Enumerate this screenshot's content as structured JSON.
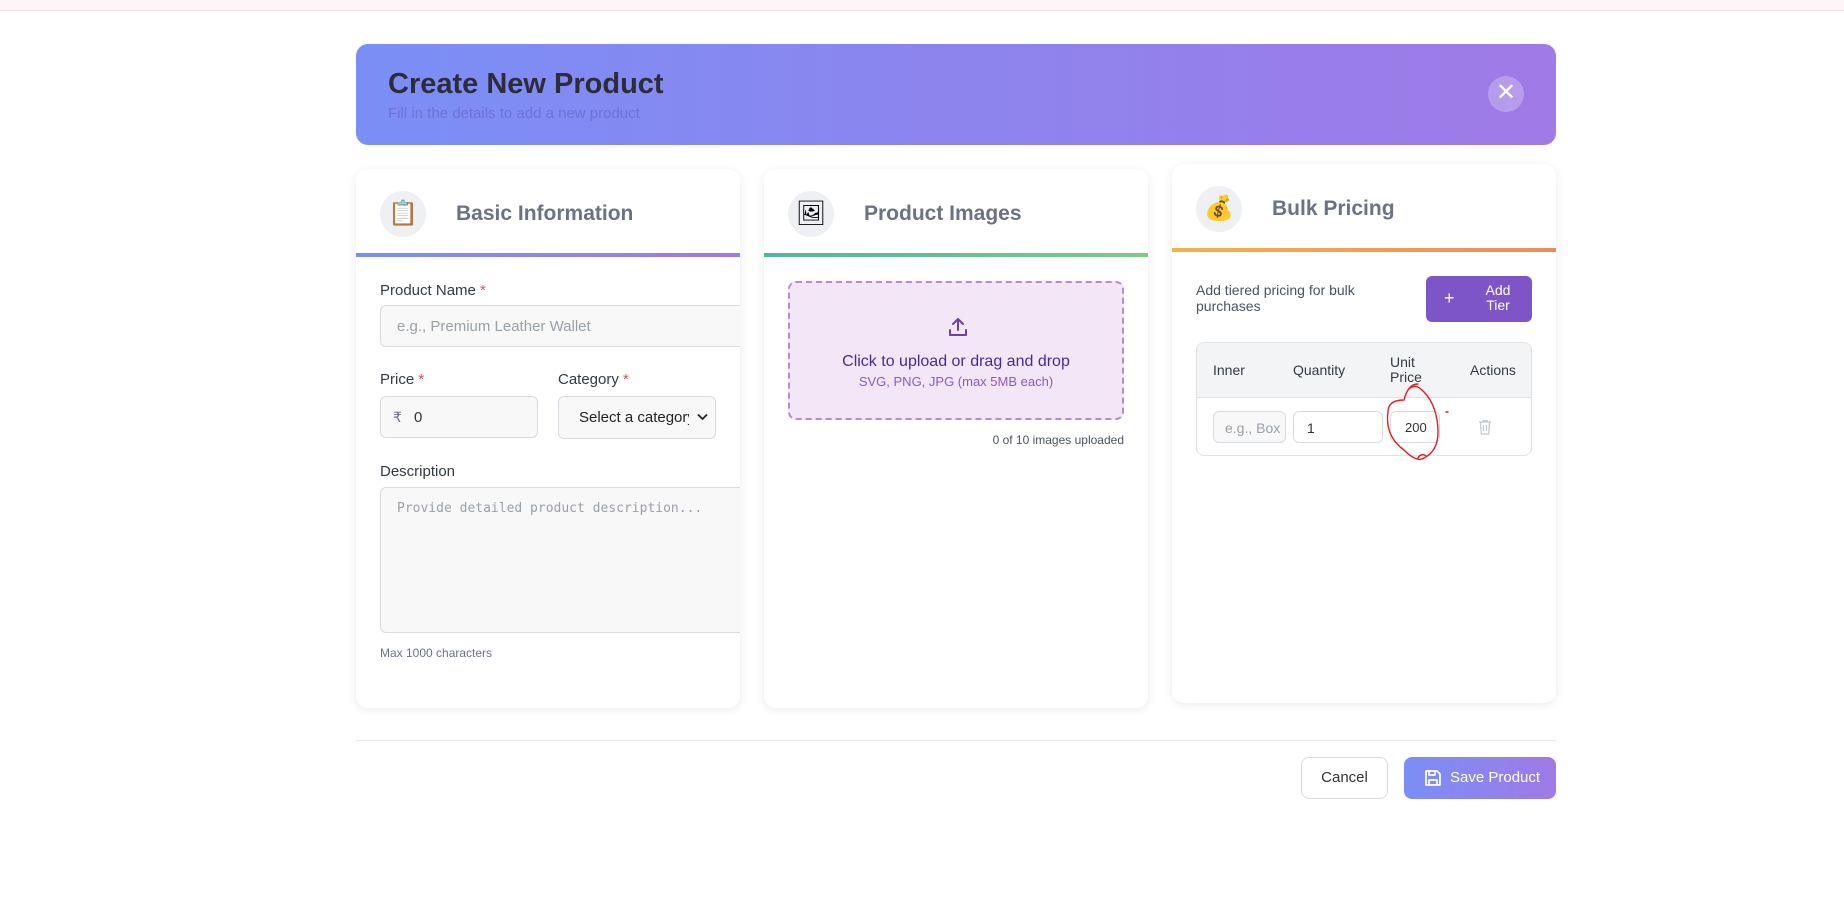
{
  "header": {
    "title": "Create New Product",
    "subtitle": "Fill in the details to add a new product",
    "close_glyph": "✕"
  },
  "basic": {
    "icon": "clipboard-icon",
    "icon_glyph": "📋",
    "title": "Basic Information",
    "product_name_label": "Product Name",
    "product_name_placeholder": "e.g., Premium Leather Wallet",
    "price_label": "Price",
    "currency_symbol": "₹",
    "price_value": "0",
    "category_label": "Category",
    "category_selected": "Select a category",
    "description_label": "Description",
    "description_placeholder": "Provide detailed product description...",
    "description_hint": "Max 1000 characters",
    "required_mark": "*"
  },
  "images": {
    "icon": "framed-picture-icon",
    "icon_glyph": "🖼",
    "title": "Product Images",
    "upload_main": "Click to upload or drag and drop",
    "upload_sub": "SVG, PNG, JPG (max 5MB each)",
    "count_text": "0 of 10 images uploaded"
  },
  "bulk": {
    "icon": "money-bag-icon",
    "icon_glyph": "💰",
    "title": "Bulk Pricing",
    "description": "Add tiered pricing for bulk purchases",
    "add_button_label": "Add Tier",
    "add_button_plus": "+",
    "columns": [
      "Inner",
      "Quantity",
      "Unit Price",
      "Actions"
    ],
    "rows": [
      {
        "inner_placeholder": "e.g., Box",
        "quantity": "1",
        "unit_price": "200"
      }
    ]
  },
  "footer": {
    "cancel_label": "Cancel",
    "save_label": "Save Product"
  },
  "colors": {
    "accent_purple": "#7d55c6",
    "header_gradient_start": "#7a8ff6",
    "header_gradient_end": "#a07ae6",
    "basic_bar": "#8b7be6",
    "images_bar": "#4fb7a0",
    "bulk_bar": "#f3a04a",
    "annotation_red": "#e02020"
  }
}
